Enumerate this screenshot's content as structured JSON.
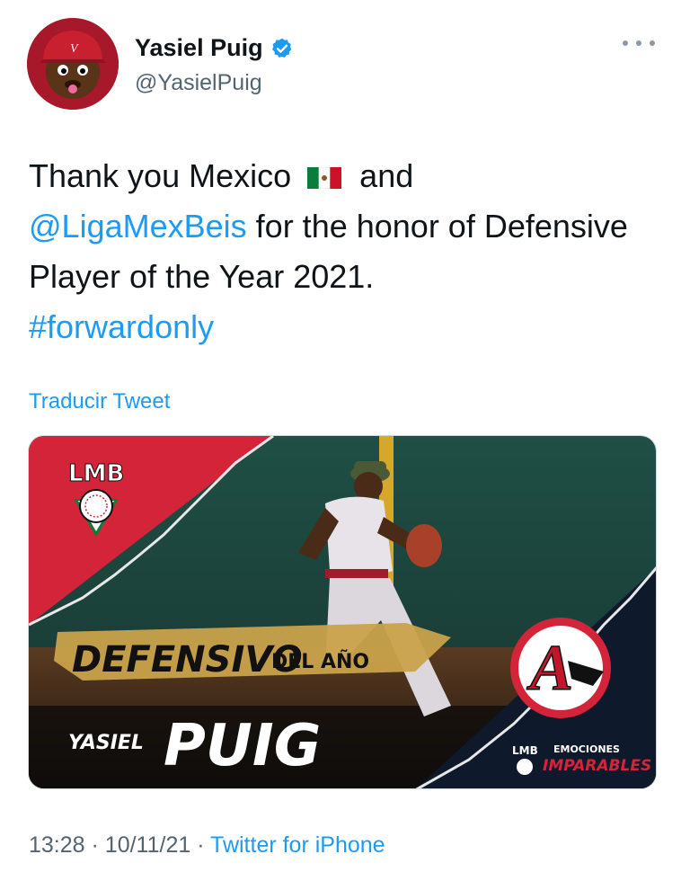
{
  "user": {
    "display_name": "Yasiel Puig",
    "handle": "@YasielPuig",
    "verified": true
  },
  "tweet": {
    "text_part1": "Thank you Mexico",
    "flag_emoji": "mexico-flag",
    "text_part2": "and",
    "mention": "@LigaMexBeis",
    "text_part3": "for the honor of Defensive Player of the Year 2021.",
    "hashtag": "#forwardonly"
  },
  "translate_label": "Traducir Tweet",
  "media": {
    "league_logo_text": "LMB",
    "award_word1": "DEFENSIVO",
    "award_word2": "DEL AÑO",
    "first_name": "YASIEL",
    "last_name": "PUIG",
    "team_logo_letter": "A",
    "footer_logo_text": "LMB",
    "footer_line1": "EMOCIONES",
    "footer_line2": "IMPARABLES"
  },
  "meta": {
    "time": "13:28",
    "date": "10/11/21",
    "separator": "·",
    "source": "Twitter for iPhone"
  },
  "colors": {
    "link": "#1d9bf0",
    "secondary_text": "#536471",
    "lmb_red": "#d4243a",
    "navy": "#0e1a2b",
    "gold": "#c9a24a"
  }
}
